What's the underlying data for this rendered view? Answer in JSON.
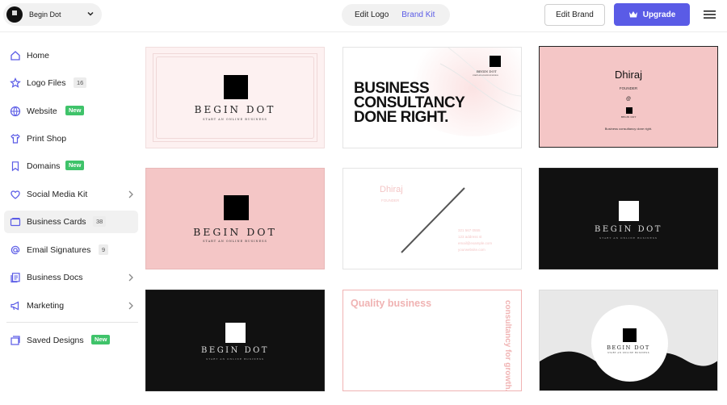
{
  "header": {
    "brand_name": "Begin Dot",
    "tabs": [
      "Edit Logo",
      "Brand Kit"
    ],
    "edit_brand_label": "Edit Brand",
    "upgrade_label": "Upgrade"
  },
  "sidebar": {
    "items": [
      {
        "label": "Home",
        "icon": "home-icon"
      },
      {
        "label": "Logo Files",
        "icon": "star-icon",
        "count": "16"
      },
      {
        "label": "Website",
        "icon": "globe-icon",
        "badge": "New"
      },
      {
        "label": "Print Shop",
        "icon": "shirt-icon"
      },
      {
        "label": "Domains",
        "icon": "bookmark-icon",
        "badge": "New"
      },
      {
        "label": "Social Media Kit",
        "icon": "heart-icon"
      },
      {
        "label": "Business Cards",
        "icon": "card-icon",
        "count": "38"
      },
      {
        "label": "Email Signatures",
        "icon": "at-icon",
        "count": "9"
      },
      {
        "label": "Business Docs",
        "icon": "docs-icon"
      },
      {
        "label": "Marketing",
        "icon": "megaphone-icon"
      },
      {
        "label": "Saved Designs",
        "icon": "saved-icon",
        "badge": "New"
      }
    ]
  },
  "cards": {
    "wordmark": "BEGIN DOT",
    "tagline": "START AN ONLINE BUSINESS",
    "headline": [
      "BUSINESS",
      "CONSULTANCY",
      "DONE RIGHT."
    ],
    "person_name": "Dhiraj",
    "person_title": "FOUNDER",
    "at_symbol": "@",
    "footer_line": "Business consultancy done right.",
    "contact_lines": [
      "321 567 0555",
      "123 address st",
      "email@example.com",
      "yourwebsite.com"
    ],
    "quality_text": "Quality business",
    "vertical_text": "consultancy for growth."
  },
  "colors": {
    "accent": "#5a5be6",
    "new_badge": "#3fc36a",
    "pink_light": "#fdf1f1",
    "pink": "#f4c6c6",
    "pink_text": "#f0b3b3",
    "dark": "#111111"
  }
}
